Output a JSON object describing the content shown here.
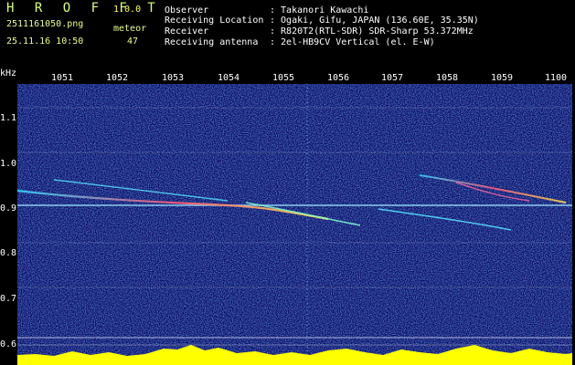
{
  "app": {
    "name": "H R O F F T",
    "version": "1.0.0"
  },
  "file": {
    "name": "2511161050.png",
    "datetime": "25.11.16 10:50"
  },
  "meteor": {
    "label": "meteor",
    "count": "47"
  },
  "info": [
    {
      "key": "Observer",
      "value": ": Takanori Kawachi"
    },
    {
      "key": "Receiving Location",
      "value": ": Ogaki, Gifu, JAPAN (136.60E, 35.35N)"
    },
    {
      "key": "Receiver",
      "value": ": R820T2(RTL-SDR) SDR-Sharp 53.372MHz"
    },
    {
      "key": "Receiving antenna",
      "value": ": 2el-HB9CV Vertical (el. E-W)"
    }
  ],
  "axis": {
    "y_unit": "kHz",
    "time_ticks": [
      "1051",
      "1052",
      "1053",
      "1054",
      "1055",
      "1056",
      "1057",
      "1058",
      "1059",
      "1100"
    ],
    "freq_ticks": [
      "1.1",
      "1.0",
      "0.9",
      "0.8",
      "0.7",
      "0.6"
    ]
  },
  "colors": {
    "background": "#0a0a5e",
    "noise": "#2a5cff",
    "signal": "#ffd84a",
    "baseline": "#ffff00"
  }
}
